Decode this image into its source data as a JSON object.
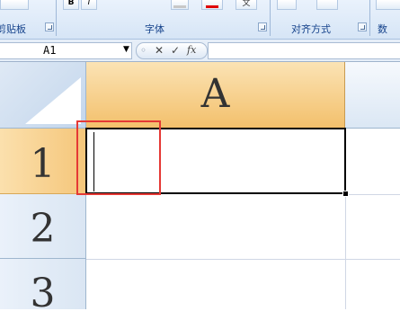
{
  "ribbon": {
    "groups": [
      {
        "label": "剪贴板"
      },
      {
        "label": "字体"
      },
      {
        "label": "对齐方式"
      },
      {
        "label": "数"
      }
    ],
    "font_buttons": {
      "bold": "B",
      "italic": "I",
      "font_color_letter": "A",
      "wen": "文"
    }
  },
  "formula_bar": {
    "name_box": "A1",
    "name_box_arrow": "▼",
    "cancel": "✕",
    "enter": "✓",
    "function": "fx",
    "formula": ""
  },
  "sheet": {
    "column_headers": [
      "A"
    ],
    "row_headers": [
      "1",
      "2",
      "3"
    ],
    "active_cell": "A1",
    "active_cell_value": "",
    "colors": {
      "selected_header": "#f5c67a",
      "header": "#dae6f3",
      "gridline": "#d0d7e5",
      "highlight_box": "#e53935"
    }
  }
}
